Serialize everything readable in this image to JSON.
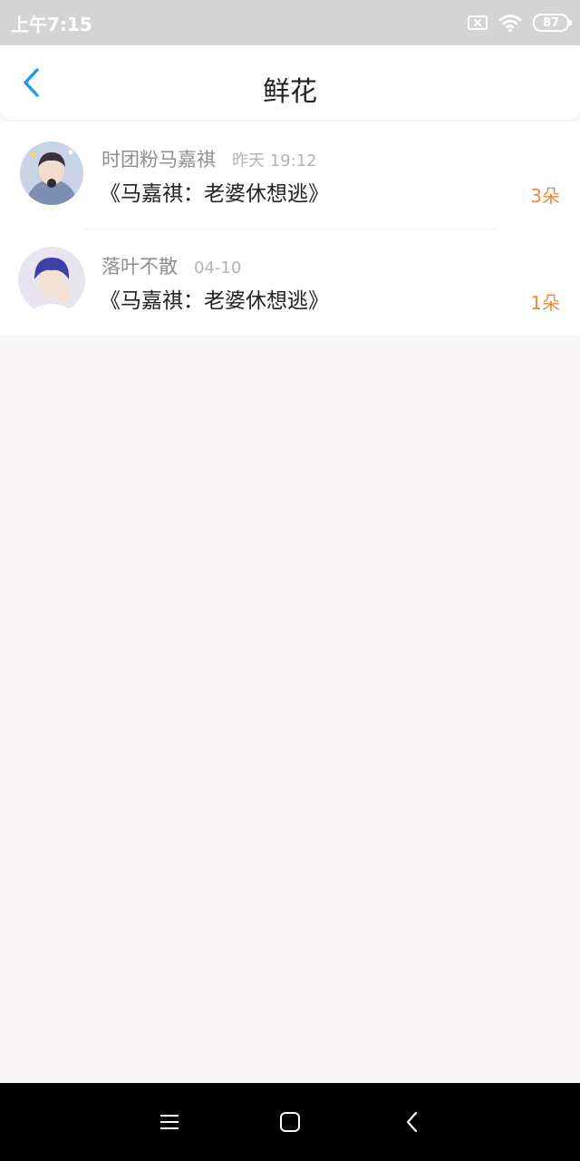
{
  "status_bar": {
    "time": "上午7:15",
    "battery": "87"
  },
  "header": {
    "title": "鲜花"
  },
  "items": [
    {
      "user": "时团粉马嘉祺",
      "time": "昨天 19:12",
      "title": "《马嘉祺：老婆休想逃》",
      "count": "3朵"
    },
    {
      "user": "落叶不散",
      "time": "04-10",
      "title": "《马嘉祺：老婆休想逃》",
      "count": "1朵"
    }
  ],
  "colors": {
    "accent_blue": "#1e9be8",
    "count_orange": "#f08a3c",
    "status_bar_bg": "#d4d4d4",
    "page_bg": "#f8f6f7"
  },
  "icons": {
    "back": "chevron-left-icon",
    "sim": "no-sim-icon",
    "wifi": "wifi-icon",
    "battery": "battery-icon",
    "nav_menu": "menu-icon",
    "nav_home": "home-icon",
    "nav_back": "back-icon"
  }
}
